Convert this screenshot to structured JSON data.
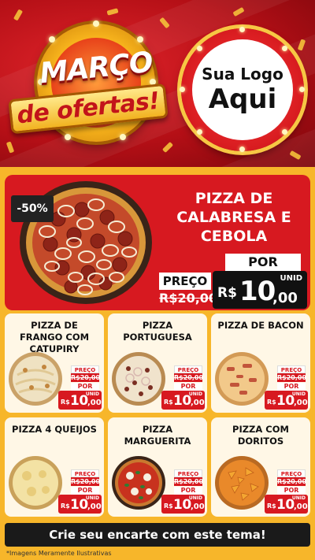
{
  "header": {
    "promo_line1": "MARÇO",
    "promo_line2": "de ofertas!",
    "logo_line1": "Sua Logo",
    "logo_line2": "Aqui"
  },
  "featured": {
    "discount": "-50%",
    "name": "PIZZA DE CALABRESA E CEBOLA",
    "preco_label": "PREÇO",
    "old_price": "R$20,00",
    "por_label": "POR",
    "unid_label": "UNID",
    "currency": "R$",
    "price_int": "10",
    "price_dec": ",00"
  },
  "cards": [
    {
      "name": "PIZZA DE FRANGO COM CATUPIRY",
      "preco_label": "PREÇO",
      "old_price": "R$20,00",
      "por_label": "POR",
      "unid_label": "UNID",
      "currency": "R$",
      "price_int": "10",
      "price_dec": ",00",
      "topping": "frango"
    },
    {
      "name": "PIZZA PORTUGUESA",
      "preco_label": "PREÇO",
      "old_price": "R$20,00",
      "por_label": "POR",
      "unid_label": "UNID",
      "currency": "R$",
      "price_int": "10",
      "price_dec": ",00",
      "topping": "portuguesa"
    },
    {
      "name": "PIZZA DE BACON",
      "preco_label": "PREÇO",
      "old_price": "R$20,00",
      "por_label": "POR",
      "unid_label": "UNID",
      "currency": "R$",
      "price_int": "10",
      "price_dec": ",00",
      "topping": "bacon"
    },
    {
      "name": "PIZZA 4 QUEIJOS",
      "preco_label": "PREÇO",
      "old_price": "R$20,00",
      "por_label": "POR",
      "unid_label": "UNID",
      "currency": "R$",
      "price_int": "10",
      "price_dec": ",00",
      "topping": "queijos"
    },
    {
      "name": "PIZZA MARGUERITA",
      "preco_label": "PREÇO",
      "old_price": "R$20,00",
      "por_label": "POR",
      "unid_label": "UNID",
      "currency": "R$",
      "price_int": "10",
      "price_dec": ",00",
      "topping": "marguerita"
    },
    {
      "name": "PIZZA COM DORITOS",
      "preco_label": "PREÇO",
      "old_price": "R$20,00",
      "por_label": "POR",
      "unid_label": "UNID",
      "currency": "R$",
      "price_int": "10",
      "price_dec": ",00",
      "topping": "doritos"
    }
  ],
  "footer": {
    "cta": "Crie seu encarte com este tema!",
    "disclaimer": "*Imagens Meramente Ilustrativas"
  },
  "colors": {
    "brand_red": "#d71920",
    "gold": "#f7b62a",
    "dark": "#111111"
  }
}
